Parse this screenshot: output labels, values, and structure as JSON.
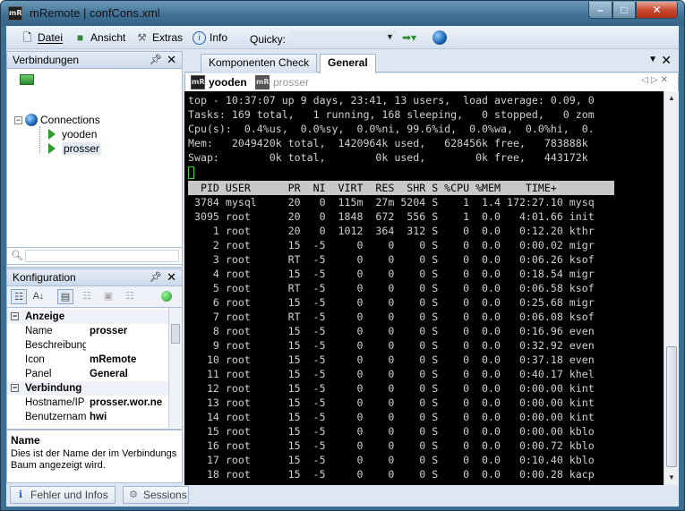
{
  "window": {
    "title": "mRemote | confCons.xml",
    "app_icon_text": "mR"
  },
  "menu": {
    "datei": "Datei",
    "ansicht": "Ansicht",
    "extras": "Extras",
    "info": "Info",
    "quicky_label": "Quicky:"
  },
  "connections_pane": {
    "title": "Verbindungen",
    "root": "Connections",
    "items": [
      "yooden",
      "prosser"
    ],
    "selected": "prosser"
  },
  "config_pane": {
    "title": "Konfiguration",
    "categories": [
      {
        "label": "Anzeige",
        "rows": [
          {
            "key": "Name",
            "value": "prosser"
          },
          {
            "key": "Beschreibung",
            "value": ""
          },
          {
            "key": "Icon",
            "value": "mRemote"
          },
          {
            "key": "Panel",
            "value": "General"
          }
        ]
      },
      {
        "label": "Verbindung",
        "rows": [
          {
            "key": "Hostname/IP",
            "value": "prosser.wor.ne"
          },
          {
            "key": "Benutzername",
            "value": "hwi"
          }
        ]
      }
    ],
    "description_title": "Name",
    "description_text": "Dies ist der Name der im Verbindungs Baum angezeigt wird."
  },
  "bottom_tabs": [
    "Fehler und Infos",
    "Sessions"
  ],
  "doc_tabs": [
    "Komponenten Check",
    "General"
  ],
  "active_doc_tab": "General",
  "session_tabs": [
    "yooden",
    "prosser"
  ],
  "active_session": "yooden",
  "terminal": {
    "lines": [
      "top - 10:37:07 up 9 days, 23:41, 13 users,  load average: 0.09, 0",
      "Tasks: 169 total,   1 running, 168 sleeping,   0 stopped,   0 zom",
      "Cpu(s):  0.4%us,  0.0%sy,  0.0%ni, 99.6%id,  0.0%wa,  0.0%hi,  0.",
      "Mem:   2049420k total,  1420964k used,   628456k free,   783888k",
      "Swap:        0k total,        0k used,        0k free,   443172k"
    ],
    "process_header": "  PID USER      PR  NI  VIRT  RES  SHR S %CPU %MEM    TIME+  ",
    "processes": [
      " 3784 mysql     20   0  115m  27m 5204 S    1  1.4 172:27.10 mysq",
      " 3095 root      20   0  1848  672  556 S    1  0.0   4:01.66 init",
      "    1 root      20   0  1012  364  312 S    0  0.0   0:12.20 kthr",
      "    2 root      15  -5     0    0    0 S    0  0.0   0:00.02 migr",
      "    3 root      RT  -5     0    0    0 S    0  0.0   0:06.26 ksof",
      "    4 root      15  -5     0    0    0 S    0  0.0   0:18.54 migr",
      "    5 root      RT  -5     0    0    0 S    0  0.0   0:06.58 ksof",
      "    6 root      15  -5     0    0    0 S    0  0.0   0:25.68 migr",
      "    7 root      RT  -5     0    0    0 S    0  0.0   0:06.08 ksof",
      "    8 root      15  -5     0    0    0 S    0  0.0   0:16.96 even",
      "    9 root      15  -5     0    0    0 S    0  0.0   0:32.92 even",
      "   10 root      15  -5     0    0    0 S    0  0.0   0:37.18 even",
      "   11 root      15  -5     0    0    0 S    0  0.0   0:40.17 khel",
      "   12 root      15  -5     0    0    0 S    0  0.0   0:00.00 kint",
      "   13 root      15  -5     0    0    0 S    0  0.0   0:00.00 kint",
      "   14 root      15  -5     0    0    0 S    0  0.0   0:00.00 kint",
      "   15 root      15  -5     0    0    0 S    0  0.0   0:00.00 kblo",
      "   16 root      15  -5     0    0    0 S    0  0.0   0:00.72 kblo",
      "   17 root      15  -5     0    0    0 S    0  0.0   0:10.40 kblo",
      "   18 root      15  -5     0    0    0 S    0  0.0   0:00.28 kacp"
    ]
  },
  "colors": {
    "terminal_bg": "#000000",
    "terminal_fg": "#d0d0d0",
    "cursor": "#3ad23a",
    "title_bar": "#3e6f93",
    "close_button": "#c7432a"
  }
}
